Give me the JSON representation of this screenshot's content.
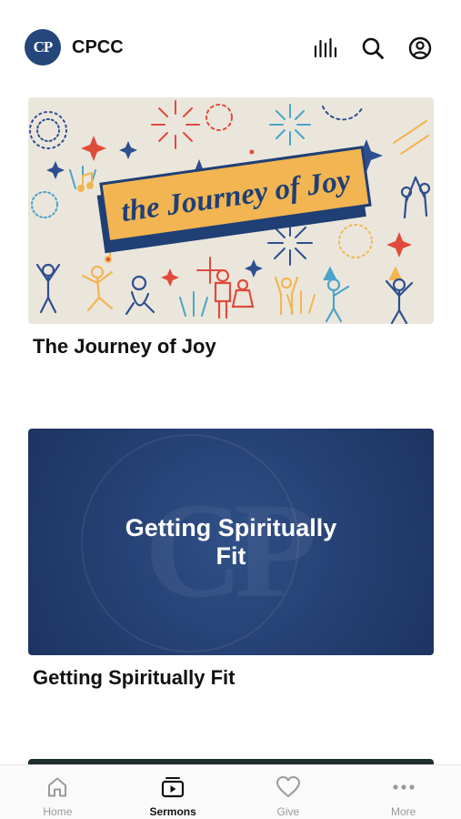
{
  "app": {
    "logo_text": "CP",
    "name": "CPCC"
  },
  "header": {
    "icons": [
      "audio-bars-icon",
      "search-icon",
      "account-icon"
    ]
  },
  "sermons": [
    {
      "title": "The Journey of Joy",
      "art_text": "the Journey of Joy"
    },
    {
      "title": "Getting Spiritually Fit",
      "art_text": "Getting Spiritually Fit",
      "art_watermark": "CP"
    }
  ],
  "nav": {
    "items": [
      {
        "label": "Home",
        "icon": "home-icon",
        "active": false
      },
      {
        "label": "Sermons",
        "icon": "sermons-icon",
        "active": true
      },
      {
        "label": "Give",
        "icon": "heart-icon",
        "active": false
      },
      {
        "label": "More",
        "icon": "more-icon",
        "active": false
      }
    ]
  },
  "colors": {
    "brand_blue": "#24467a",
    "joy_banner": "#f2b552",
    "joy_background": "#ebe6dc",
    "fit_background": "#253f72",
    "active_nav": "#111111",
    "inactive_nav": "#9a9a9a"
  }
}
